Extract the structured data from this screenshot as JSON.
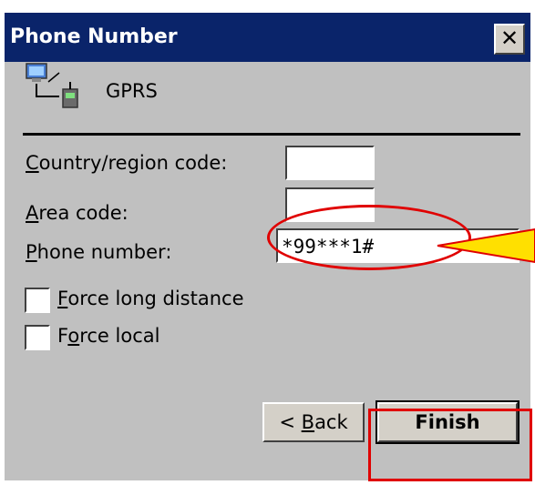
{
  "window": {
    "title": "Phone Number",
    "close_icon": "close-icon"
  },
  "connection": {
    "icon": "network-connection-icon",
    "name": "GPRS"
  },
  "form": {
    "country_label_pre": "",
    "country_label_u": "C",
    "country_label_post": "ountry/region code:",
    "country_value": "",
    "area_label_u": "A",
    "area_label_post": "rea code:",
    "area_value": "",
    "phone_label_u": "P",
    "phone_label_post": "hone number:",
    "phone_value": "*99***1#"
  },
  "options": {
    "force_long_pre": "",
    "force_long_u": "F",
    "force_long_post": "orce long distance",
    "force_long_checked": false,
    "force_local_pre": "F",
    "force_local_u": "o",
    "force_local_post": "rce local",
    "force_local_checked": false
  },
  "buttons": {
    "back_pre": "< ",
    "back_u": "B",
    "back_post": "ack",
    "finish": "Finish"
  },
  "annotations": {
    "highlight_color": "#e00000",
    "pointer_color": "#ffe000"
  }
}
